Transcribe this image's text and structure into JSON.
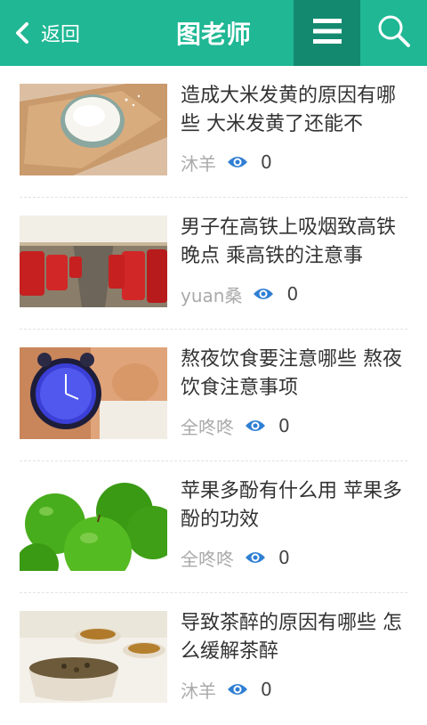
{
  "header": {
    "back_label": "返回",
    "title": "图老师",
    "menu_icon": "menu-icon",
    "search_icon": "search-icon"
  },
  "colors": {
    "header_bg": "#1fb794",
    "menu_bg": "#138a6f",
    "eye": "#2f7fd3"
  },
  "articles": [
    {
      "title": "造成大米发黄的原因有哪些 大米发黄了还能不",
      "author": "沐羊",
      "views": "0",
      "thumb": "rice-bowl"
    },
    {
      "title": "男子在高铁上吸烟致高铁晚点 乘高铁的注意事",
      "author": "yuan桑",
      "views": "0",
      "thumb": "train-seats"
    },
    {
      "title": "熬夜饮食要注意哪些 熬夜饮食注意事项",
      "author": "全咚咚",
      "views": "0",
      "thumb": "alarm-clock"
    },
    {
      "title": "苹果多酚有什么用 苹果多酚的功效",
      "author": "全咚咚",
      "views": "0",
      "thumb": "green-apples"
    },
    {
      "title": "导致茶醉的原因有哪些 怎么缓解茶醉",
      "author": "沐羊",
      "views": "0",
      "thumb": "tea-cups"
    }
  ]
}
